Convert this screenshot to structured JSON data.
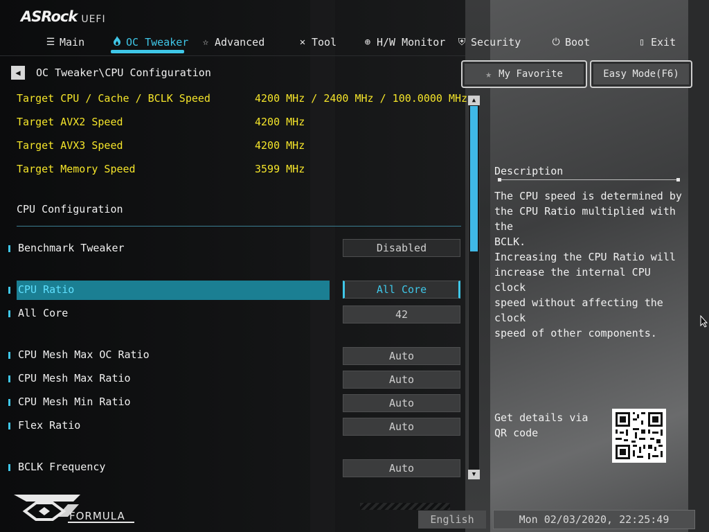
{
  "header": {
    "brand": "ASRock",
    "sub": "UEFI"
  },
  "tabs": [
    {
      "label": "Main",
      "icon": "list-icon"
    },
    {
      "label": "OC Tweaker",
      "icon": "flame-icon",
      "active": true
    },
    {
      "label": "Advanced",
      "icon": "star-outline-icon"
    },
    {
      "label": "Tool",
      "icon": "tools-icon"
    },
    {
      "label": "H/W Monitor",
      "icon": "monitor-icon"
    },
    {
      "label": "Security",
      "icon": "shield-icon"
    },
    {
      "label": "Boot",
      "icon": "power-icon"
    },
    {
      "label": "Exit",
      "icon": "exit-door-icon"
    }
  ],
  "breadcrumb": "OC Tweaker\\CPU Configuration",
  "buttons": {
    "favorite": "My Favorite",
    "easy_mode": "Easy Mode(F6)"
  },
  "info": [
    {
      "label": "Target CPU / Cache / BCLK Speed",
      "value": "4200 MHz / 2400 MHz / 100.0000 MHz"
    },
    {
      "label": "Target AVX2 Speed",
      "value": "4200 MHz"
    },
    {
      "label": "Target AVX3 Speed",
      "value": "4200 MHz"
    },
    {
      "label": "Target Memory Speed",
      "value": "3599 MHz"
    }
  ],
  "section_title": "CPU Configuration",
  "settings": [
    {
      "label": "Benchmark Tweaker",
      "value": "Disabled"
    },
    {
      "label": "CPU Ratio",
      "value": "All Core",
      "selected": true
    },
    {
      "label": "All Core",
      "value": "42"
    },
    {
      "label": "CPU Mesh Max OC Ratio",
      "value": "Auto"
    },
    {
      "label": "CPU Mesh Max Ratio",
      "value": "Auto"
    },
    {
      "label": "CPU Mesh Min Ratio",
      "value": "Auto"
    },
    {
      "label": "Flex Ratio",
      "value": "Auto"
    },
    {
      "label": "BCLK Frequency",
      "value": "Auto"
    }
  ],
  "description": {
    "title": "Description",
    "text": "The CPU speed is determined by\nthe CPU Ratio multiplied with the\nBCLK.\nIncreasing the CPU Ratio will\nincrease the internal CPU clock\nspeed without affecting the clock\nspeed of other components."
  },
  "qr": {
    "text": "Get details via QR code"
  },
  "footer": {
    "logo_text": "FORMULA",
    "language": "English",
    "datetime": "Mon 02/03/2020, 22:25:49"
  },
  "colors": {
    "accent": "#3fc7e8",
    "highlight_row": "#1b7f93",
    "info_text": "#f5e52a"
  }
}
